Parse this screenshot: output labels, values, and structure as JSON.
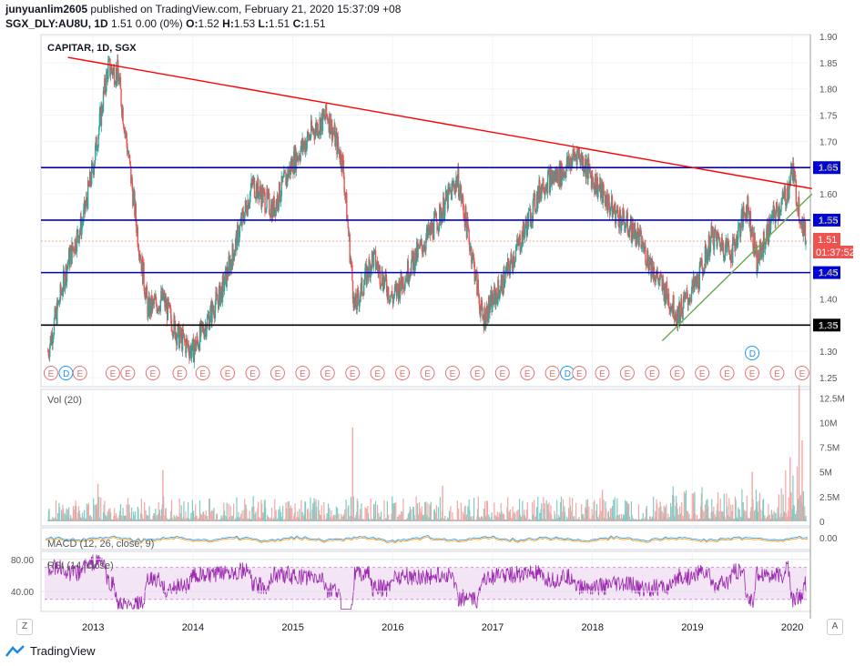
{
  "header": {
    "user": "junyuanlim2605",
    "published": "published on TradingView.com, February 21, 2020 15:37:09 +08",
    "symbol": "SGX_DLY:AU8U, 1D",
    "ohlc": "1.51 0.00 (0%)",
    "o_label": "O:",
    "o": "1.52",
    "h_label": "H:",
    "h": "1.53",
    "l_label": "L:",
    "l": "1.51",
    "c_label": "C:",
    "c": "1.51"
  },
  "panes": {
    "main_title": "CAPITAR, 1D, SGX",
    "vol_title": "Vol (20)",
    "macd_title": "MACD (12, 26, close, 9)",
    "rsi_title": "RSI (14, close)"
  },
  "badges": {
    "last_price": "1.51",
    "countdown": "01:37:52",
    "z_button": "Z",
    "a_button": "A"
  },
  "footer": {
    "brand": "TradingView"
  },
  "colors": {
    "up": "#26a69a",
    "down": "#ef5350",
    "blue_line": "#0000d8",
    "black_line": "#000000",
    "trend_red": "#ff0000",
    "trend_green": "#6aa84f",
    "rsi": "#9c27b0",
    "rsi_band": "#f3e5f5"
  },
  "chart_data": [
    {
      "type": "candlestick",
      "title": "CAPITAR, 1D, SGX",
      "x_ticks": [
        "2013",
        "2014",
        "2015",
        "2016",
        "2017",
        "2018",
        "2019",
        "2020"
      ],
      "y_ticks": [
        "1.90",
        "1.85",
        "1.80",
        "1.75",
        "1.70",
        "1.65",
        "1.60",
        "1.55",
        "1.50",
        "1.45",
        "1.40",
        "1.35",
        "1.30",
        "1.25"
      ],
      "ylim": [
        1.25,
        1.9
      ],
      "price_path": [
        {
          "t": 2012.55,
          "p": 1.3
        },
        {
          "t": 2012.75,
          "p": 1.47
        },
        {
          "t": 2012.9,
          "p": 1.55
        },
        {
          "t": 2013.0,
          "p": 1.65
        },
        {
          "t": 2013.15,
          "p": 1.84
        },
        {
          "t": 2013.25,
          "p": 1.83
        },
        {
          "t": 2013.35,
          "p": 1.68
        },
        {
          "t": 2013.45,
          "p": 1.52
        },
        {
          "t": 2013.55,
          "p": 1.38
        },
        {
          "t": 2013.7,
          "p": 1.4
        },
        {
          "t": 2013.85,
          "p": 1.33
        },
        {
          "t": 2014.0,
          "p": 1.3
        },
        {
          "t": 2014.15,
          "p": 1.36
        },
        {
          "t": 2014.3,
          "p": 1.42
        },
        {
          "t": 2014.45,
          "p": 1.52
        },
        {
          "t": 2014.6,
          "p": 1.62
        },
        {
          "t": 2014.8,
          "p": 1.57
        },
        {
          "t": 2015.0,
          "p": 1.66
        },
        {
          "t": 2015.2,
          "p": 1.72
        },
        {
          "t": 2015.35,
          "p": 1.75
        },
        {
          "t": 2015.5,
          "p": 1.66
        },
        {
          "t": 2015.62,
          "p": 1.38
        },
        {
          "t": 2015.8,
          "p": 1.48
        },
        {
          "t": 2016.0,
          "p": 1.4
        },
        {
          "t": 2016.2,
          "p": 1.47
        },
        {
          "t": 2016.45,
          "p": 1.55
        },
        {
          "t": 2016.65,
          "p": 1.63
        },
        {
          "t": 2016.8,
          "p": 1.48
        },
        {
          "t": 2016.9,
          "p": 1.36
        },
        {
          "t": 2017.1,
          "p": 1.43
        },
        {
          "t": 2017.3,
          "p": 1.52
        },
        {
          "t": 2017.5,
          "p": 1.62
        },
        {
          "t": 2017.7,
          "p": 1.64
        },
        {
          "t": 2017.85,
          "p": 1.68
        },
        {
          "t": 2018.0,
          "p": 1.63
        },
        {
          "t": 2018.2,
          "p": 1.57
        },
        {
          "t": 2018.45,
          "p": 1.52
        },
        {
          "t": 2018.65,
          "p": 1.44
        },
        {
          "t": 2018.85,
          "p": 1.37
        },
        {
          "t": 2019.05,
          "p": 1.43
        },
        {
          "t": 2019.2,
          "p": 1.52
        },
        {
          "t": 2019.4,
          "p": 1.49
        },
        {
          "t": 2019.55,
          "p": 1.58
        },
        {
          "t": 2019.65,
          "p": 1.47
        },
        {
          "t": 2019.8,
          "p": 1.55
        },
        {
          "t": 2019.95,
          "p": 1.6
        },
        {
          "t": 2020.0,
          "p": 1.65
        },
        {
          "t": 2020.05,
          "p": 1.59
        },
        {
          "t": 2020.14,
          "p": 1.51
        }
      ],
      "horizontal_lines": [
        {
          "price": 1.65,
          "label": "1.65",
          "color": "#0000d8"
        },
        {
          "price": 1.55,
          "label": "1.55",
          "color": "#0000d8"
        },
        {
          "price": 1.45,
          "label": "1.45",
          "color": "#0000d8"
        },
        {
          "price": 1.35,
          "label": "1.35",
          "color": "#000000"
        }
      ],
      "trendlines": [
        {
          "name": "resistance",
          "color": "#ff0000",
          "from": {
            "t": 2012.75,
            "p": 1.86
          },
          "to": {
            "t": 2020.2,
            "p": 1.61
          }
        },
        {
          "name": "support",
          "color": "#6aa84f",
          "from": {
            "t": 2018.7,
            "p": 1.32
          },
          "to": {
            "t": 2020.2,
            "p": 1.6
          }
        }
      ],
      "events": [
        {
          "t": 2012.58,
          "k": "E"
        },
        {
          "t": 2012.73,
          "k": "D"
        },
        {
          "t": 2012.87,
          "k": "E"
        },
        {
          "t": 2013.2,
          "k": "E"
        },
        {
          "t": 2013.35,
          "k": "E"
        },
        {
          "t": 2013.6,
          "k": "E"
        },
        {
          "t": 2013.87,
          "k": "E"
        },
        {
          "t": 2014.1,
          "k": "E"
        },
        {
          "t": 2014.35,
          "k": "E"
        },
        {
          "t": 2014.6,
          "k": "E"
        },
        {
          "t": 2014.85,
          "k": "E"
        },
        {
          "t": 2015.1,
          "k": "E"
        },
        {
          "t": 2015.35,
          "k": "E"
        },
        {
          "t": 2015.6,
          "k": "E"
        },
        {
          "t": 2015.85,
          "k": "E"
        },
        {
          "t": 2016.1,
          "k": "E"
        },
        {
          "t": 2016.35,
          "k": "E"
        },
        {
          "t": 2016.6,
          "k": "E"
        },
        {
          "t": 2016.85,
          "k": "E"
        },
        {
          "t": 2017.1,
          "k": "E"
        },
        {
          "t": 2017.35,
          "k": "E"
        },
        {
          "t": 2017.6,
          "k": "E"
        },
        {
          "t": 2017.75,
          "k": "D"
        },
        {
          "t": 2017.87,
          "k": "E"
        },
        {
          "t": 2018.1,
          "k": "E"
        },
        {
          "t": 2018.35,
          "k": "E"
        },
        {
          "t": 2018.6,
          "k": "E"
        },
        {
          "t": 2018.85,
          "k": "E"
        },
        {
          "t": 2019.1,
          "k": "E"
        },
        {
          "t": 2019.35,
          "k": "E"
        },
        {
          "t": 2019.6,
          "k": "E"
        },
        {
          "t": 2019.85,
          "k": "E"
        },
        {
          "t": 2020.1,
          "k": "E"
        },
        {
          "t": 2019.6,
          "k": "D",
          "upper": true
        }
      ]
    },
    {
      "type": "bar",
      "title": "Vol (20)",
      "y_ticks": [
        "12.5M",
        "10M",
        "7.5M",
        "5M",
        "2.5M",
        "0"
      ],
      "ylim": [
        0,
        14
      ],
      "spikes": [
        {
          "t": 2015.6,
          "v": 9.5
        },
        {
          "t": 2013.7,
          "v": 5.2
        },
        {
          "t": 2013.05,
          "v": 3.8
        },
        {
          "t": 2016.5,
          "v": 3.6
        },
        {
          "t": 2018.1,
          "v": 3.2
        },
        {
          "t": 2019.6,
          "v": 5.0
        },
        {
          "t": 2019.98,
          "v": 6.5
        },
        {
          "t": 2020.07,
          "v": 13.8
        },
        {
          "t": 2020.1,
          "v": 8.2
        }
      ]
    },
    {
      "type": "line",
      "title": "MACD (12, 26, close, 9)",
      "y_ticks": [
        "0.00"
      ]
    },
    {
      "type": "line",
      "title": "RSI (14, close)",
      "y_ticks": [
        "80.00",
        "40.00"
      ],
      "band": [
        30,
        70
      ],
      "ylim": [
        15,
        90
      ]
    }
  ]
}
